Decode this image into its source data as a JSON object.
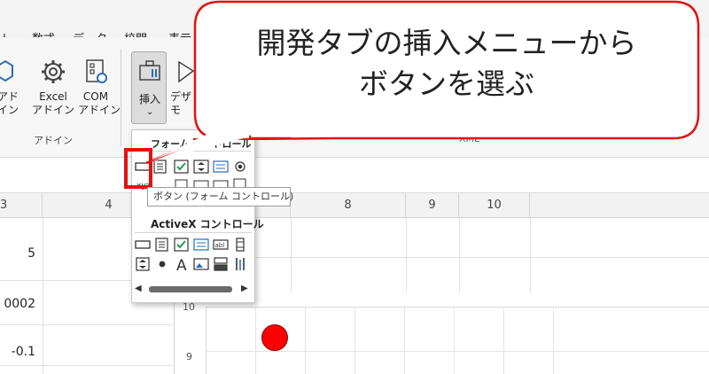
{
  "ribbon_tabs": [
    "ト",
    "数式",
    "データ",
    "校閲",
    "表示"
  ],
  "ribbon_buttons": {
    "addin_partial": "アド\nイン",
    "excel_addin": "Excel\nアドイン",
    "com_addin": "COM\nアドイン",
    "insert": "挿入",
    "design_partial": "デザ\nモ"
  },
  "group_labels": {
    "addins": "アドイン",
    "xml": "XML"
  },
  "dropdown": {
    "form_title": "フォーム コントロール",
    "activex_title": "ActiveX コントロール",
    "tooltip": "ボタン (フォーム コントロール)"
  },
  "column_headers": [
    "3",
    "4",
    "8",
    "9",
    "10"
  ],
  "cells": [
    "5",
    "0002",
    "-0.1"
  ],
  "chart_axis": [
    "10",
    "9"
  ],
  "callout": {
    "line1": "開発タブの挿入メニューから",
    "line2": "ボタンを選ぶ"
  },
  "colors": {
    "highlight": "#e21212",
    "callout_border": "#e21212",
    "marker": "#ff0000",
    "checkbox": "#22a049"
  }
}
